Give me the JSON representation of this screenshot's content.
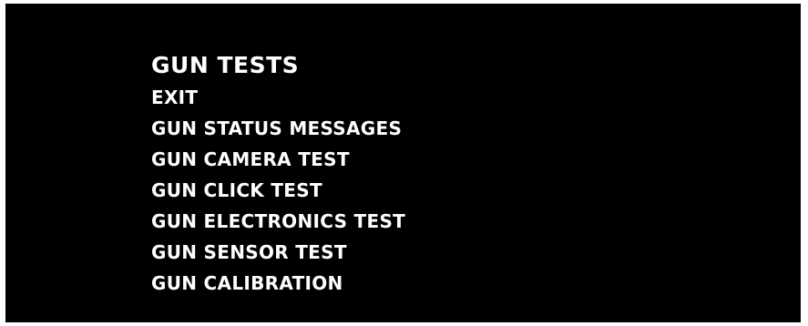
{
  "menu": {
    "title": "GUN TESTS",
    "items": [
      {
        "label": "EXIT"
      },
      {
        "label": "GUN STATUS MESSAGES"
      },
      {
        "label": "GUN CAMERA TEST"
      },
      {
        "label": "GUN CLICK TEST"
      },
      {
        "label": "GUN ELECTRONICS TEST"
      },
      {
        "label": "GUN SENSOR TEST"
      },
      {
        "label": "GUN CALIBRATION"
      }
    ]
  },
  "colors": {
    "background": "#000000",
    "text": "#ffffff"
  }
}
